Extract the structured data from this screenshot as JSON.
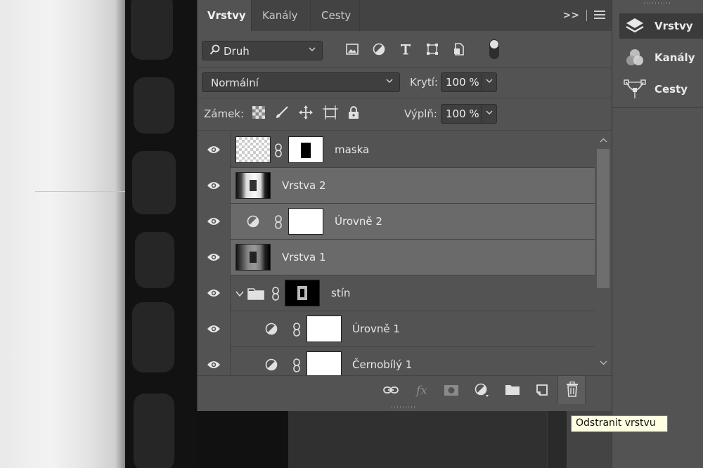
{
  "tabs": [
    "Vrstvy",
    "Kanály",
    "Cesty"
  ],
  "filter": {
    "label": "Druh",
    "icons": [
      "image-filter-icon",
      "adjustment-filter-icon",
      "type-filter-icon",
      "shape-filter-icon",
      "smart-object-filter-icon"
    ]
  },
  "blend": {
    "mode": "Normální",
    "opacity_label": "Krytí:",
    "opacity_value": "100 %"
  },
  "lock": {
    "label": "Zámek:",
    "fill_label": "Výplň:",
    "fill_value": "100 %",
    "icons": [
      "lock-transparent-icon",
      "lock-paint-icon",
      "lock-move-icon",
      "lock-artboard-icon",
      "lock-all-icon"
    ]
  },
  "layers": [
    {
      "name": "maska",
      "selected": false
    },
    {
      "name": "Vrstva 2",
      "selected": true
    },
    {
      "name": "Úrovně 2",
      "selected": true
    },
    {
      "name": "Vrstva 1",
      "selected": true
    },
    {
      "name": "stín",
      "selected": false,
      "group": true
    },
    {
      "name": "Úrovně 1",
      "selected": false
    },
    {
      "name": "Černobílý 1",
      "selected": false
    }
  ],
  "bottom_icons": [
    "link-layers-icon",
    "fx-icon",
    "add-mask-icon",
    "new-adjustment-icon",
    "new-group-icon",
    "new-layer-icon",
    "delete-layer-icon"
  ],
  "dock": [
    {
      "label": "Vrstvy",
      "icon": "layers-icon",
      "active": true
    },
    {
      "label": "Kanály",
      "icon": "channels-icon",
      "active": false
    },
    {
      "label": "Cesty",
      "icon": "paths-icon",
      "active": false
    }
  ],
  "tooltip": "Odstranit vrstvu"
}
